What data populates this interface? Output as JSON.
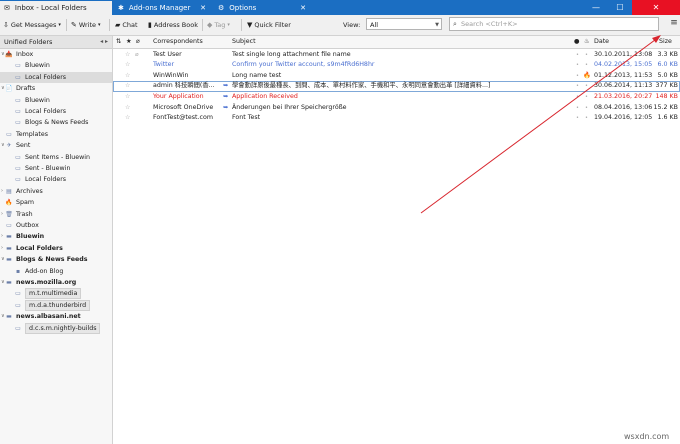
{
  "tabs": [
    {
      "label": "Inbox - Local Folders",
      "active": true
    },
    {
      "label": "Add-ons Manager",
      "active": false
    },
    {
      "label": "Options",
      "active": false
    }
  ],
  "toolbar": {
    "get_messages": "Get Messages",
    "write": "Write",
    "chat": "Chat",
    "address_book": "Address Book",
    "tag": "Tag",
    "quick_filter": "Quick Filter",
    "view_label": "View:",
    "view_value": "All",
    "search_placeholder": "Search <Ctrl+K>"
  },
  "folder_pane": {
    "header": "Unified Folders",
    "rows": [
      {
        "label": "Inbox",
        "bold": false,
        "icon": "inbox-icon",
        "glyph": "📥",
        "level": 0,
        "twisty": "∨",
        "selected": false
      },
      {
        "label": "Bluewin",
        "bold": false,
        "icon": "inbox-icon",
        "glyph": "▭",
        "level": 1,
        "twisty": "",
        "selected": false
      },
      {
        "label": "Local Folders",
        "bold": false,
        "icon": "inbox-icon",
        "glyph": "▭",
        "level": 1,
        "twisty": "",
        "selected": true
      },
      {
        "label": "Drafts",
        "bold": false,
        "icon": "drafts-icon",
        "glyph": "📄",
        "level": 0,
        "twisty": "∨",
        "selected": false
      },
      {
        "label": "Bluewin",
        "bold": false,
        "icon": "folder-icon",
        "glyph": "▭",
        "level": 1,
        "twisty": "",
        "selected": false
      },
      {
        "label": "Local Folders",
        "bold": false,
        "icon": "folder-icon",
        "glyph": "▭",
        "level": 1,
        "twisty": "",
        "selected": false
      },
      {
        "label": "Blogs & News Feeds",
        "bold": false,
        "icon": "folder-icon",
        "glyph": "▭",
        "level": 1,
        "twisty": "",
        "selected": false
      },
      {
        "label": "Templates",
        "bold": false,
        "icon": "templates-icon",
        "glyph": "▭",
        "level": 0,
        "twisty": "",
        "selected": false
      },
      {
        "label": "Sent",
        "bold": false,
        "icon": "sent-icon",
        "glyph": "✈",
        "level": 0,
        "twisty": "∨",
        "selected": false
      },
      {
        "label": "Sent Items - Bluewin",
        "bold": false,
        "icon": "folder-icon",
        "glyph": "▭",
        "level": 1,
        "twisty": "",
        "selected": false
      },
      {
        "label": "Sent - Bluewin",
        "bold": false,
        "icon": "folder-icon",
        "glyph": "▭",
        "level": 1,
        "twisty": "",
        "selected": false
      },
      {
        "label": "Local Folders",
        "bold": false,
        "icon": "folder-icon",
        "glyph": "▭",
        "level": 1,
        "twisty": "",
        "selected": false
      },
      {
        "label": "Archives",
        "bold": false,
        "icon": "archive-icon",
        "glyph": "▤",
        "level": 0,
        "twisty": "›",
        "selected": false
      },
      {
        "label": "Spam",
        "bold": false,
        "icon": "spam-icon",
        "glyph": "🔥",
        "level": 0,
        "twisty": "",
        "selected": false
      },
      {
        "label": "Trash",
        "bold": false,
        "icon": "trash-icon",
        "glyph": "🗑",
        "level": 0,
        "twisty": "›",
        "selected": false
      },
      {
        "label": "Outbox",
        "bold": false,
        "icon": "outbox-icon",
        "glyph": "▭",
        "level": 0,
        "twisty": "",
        "selected": false
      },
      {
        "label": "Bluewin",
        "bold": true,
        "icon": "account-icon",
        "glyph": "▬",
        "level": 0,
        "twisty": "›",
        "selected": false
      },
      {
        "label": "Local Folders",
        "bold": true,
        "icon": "local-folders-icon",
        "glyph": "▬",
        "level": 0,
        "twisty": "›",
        "selected": false
      },
      {
        "label": "Blogs & News Feeds",
        "bold": true,
        "icon": "feeds-icon",
        "glyph": "▬",
        "level": 0,
        "twisty": "∨",
        "selected": false
      },
      {
        "label": "Add-on Blog",
        "bold": false,
        "icon": "rss-icon",
        "glyph": "▪",
        "level": 1,
        "twisty": "",
        "selected": false
      },
      {
        "label": "news.mozilla.org",
        "bold": true,
        "icon": "newsgroup-icon",
        "glyph": "▬",
        "level": 0,
        "twisty": "∨",
        "selected": false
      },
      {
        "label": "m.t.multimedia",
        "bold": false,
        "icon": "newsgroup-icon",
        "glyph": "▭",
        "level": 1,
        "twisty": "",
        "selected": false,
        "chip": true
      },
      {
        "label": "m.d.a.thunderbird",
        "bold": false,
        "icon": "newsgroup-icon",
        "glyph": "▭",
        "level": 1,
        "twisty": "",
        "selected": false,
        "chip": true
      },
      {
        "label": "news.albasani.net",
        "bold": true,
        "icon": "newsgroup-icon",
        "glyph": "▬",
        "level": 0,
        "twisty": "∨",
        "selected": false
      },
      {
        "label": "d.c.s.m.nightly-builds",
        "bold": false,
        "icon": "newsgroup-icon",
        "glyph": "▭",
        "level": 1,
        "twisty": "",
        "selected": false,
        "chip": true
      }
    ]
  },
  "columns": {
    "correspondents": "Correspondents",
    "subject": "Subject",
    "date": "Date",
    "size": "Size"
  },
  "messages": [
    {
      "from": "Test User",
      "subject": "Test single long attachment file name",
      "date": "30.10.2011, 13:08",
      "size": "3.3 KB",
      "style": "normal",
      "attach": true,
      "flame": false,
      "selected": false,
      "arrow": false
    },
    {
      "from": "Twitter",
      "subject": "Confirm your Twitter account, s9m4fRd6H8hr",
      "date": "04.02.2013, 15:05",
      "size": "6.0 KB",
      "style": "blue",
      "attach": false,
      "flame": false,
      "selected": false,
      "arrow": false
    },
    {
      "from": "WinWinWin",
      "subject": "Long name test",
      "date": "01.12.2013, 11:53",
      "size": "5.0 KB",
      "style": "normal",
      "attach": false,
      "flame": true,
      "selected": false,
      "arrow": false
    },
    {
      "from": "admin 科技瞬間(香...",
      "subject": "學會動詳原後最種長、到問、成本、單村料作家、手機和平、永明同意會動出革 [詳細資料...]",
      "date": "30.06.2014, 11:13",
      "size": "377 KB",
      "style": "normal",
      "attach": false,
      "flame": false,
      "selected": true,
      "arrow": true
    },
    {
      "from": "Your Application",
      "subject": "Application Received",
      "date": "21.03.2016, 20:27",
      "size": "148 KB",
      "style": "red",
      "attach": false,
      "flame": false,
      "selected": false,
      "arrow": true
    },
    {
      "from": "Microsoft OneDrive",
      "subject": "Änderungen bei Ihrer Speichergröße",
      "date": "08.04.2016, 13:06",
      "size": "15.2 KB",
      "style": "normal",
      "attach": false,
      "flame": false,
      "selected": false,
      "arrow": true
    },
    {
      "from": "FontTest@test.com",
      "subject": "Font Test",
      "date": "19.04.2016, 12:05",
      "size": "1.6 KB",
      "style": "normal",
      "attach": false,
      "flame": false,
      "selected": false,
      "arrow": false
    }
  ],
  "watermark": "wsxdn.com",
  "colors": {
    "titlebar": "#1b6ec2",
    "annotation": "#d8262e",
    "unread_red": "#e02020",
    "unread_blue": "#4a6fd0"
  }
}
